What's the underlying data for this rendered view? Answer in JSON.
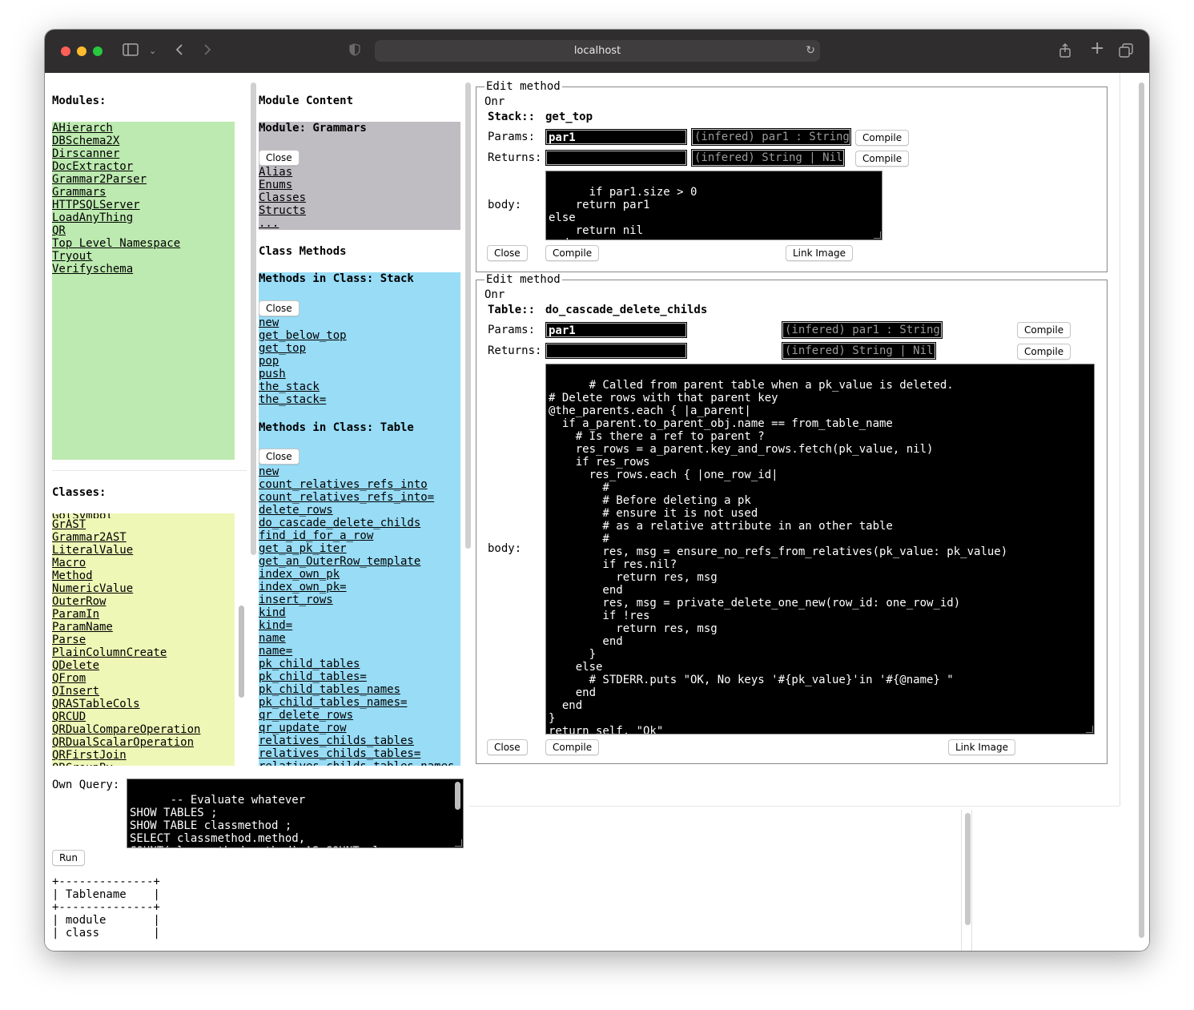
{
  "browser": {
    "url": "localhost"
  },
  "modules": {
    "title": "Modules:",
    "items": [
      "AHierarch",
      "DBSchema2X",
      "Dirscanner",
      "DocExtractor",
      "Grammar2Parser",
      "Grammars",
      "HTTPSQLServer",
      "LoadAnyThing",
      "QR",
      "Top Level Namespace",
      "Tryout",
      "Verifyschema"
    ]
  },
  "classes": {
    "title": "Classes:",
    "partial_top": "GotSymbol",
    "items": [
      "GrAST",
      "Grammar2AST",
      "LiteralValue",
      "Macro",
      "Method",
      "NumericValue",
      "OuterRow",
      "ParamIn",
      "ParamName",
      "Parse",
      "PlainColumnCreate",
      "QDelete",
      "QFrom",
      "QInsert",
      "QRASTableCols",
      "QRCUD",
      "QRDualCompareOperation",
      "QRDualScalarOperation",
      "QRFirstJoin"
    ],
    "partial_bottom": "QRGroupBy"
  },
  "module_content": {
    "title": "Module Content",
    "module_header": "Module: Grammars",
    "close_label": "Close",
    "items": [
      "Alias",
      "Enums",
      "Classes",
      "Structs",
      "..."
    ]
  },
  "class_methods": {
    "title": "Class Methods",
    "stack": {
      "header": "Methods in Class: Stack",
      "close_label": "Close",
      "items": [
        "new",
        "get_below_top",
        "get_top",
        "pop",
        "push",
        "the_stack",
        "the_stack="
      ]
    },
    "table": {
      "header": "Methods in Class: Table",
      "close_label": "Close",
      "items": [
        "new",
        "count_relatives_refs_into",
        "count_relatives_refs_into=",
        "delete_rows",
        "do_cascade_delete_childs",
        "find_id_for_a_row",
        "get_a_pk_iter",
        "get_an_OuterRow_template",
        "index_own_pk",
        "index_own_pk=",
        "insert_rows",
        "kind",
        "kind=",
        "name",
        "name=",
        "pk_child_tables",
        "pk_child_tables=",
        "pk_child_tables_names",
        "pk_child_tables_names=",
        "qr_delete_rows",
        "qr_update_row",
        "relatives_childs_tables",
        "relatives_childs_tables="
      ],
      "partial_bottom": "relatives_childs_tables_names"
    }
  },
  "edit1": {
    "legend": "Edit method",
    "owner": "Onr",
    "class_label": "Stack::",
    "method_name": "get_top",
    "params_label": "Params:",
    "params_value": "par1",
    "params_inferred": "(infered) par1 : String",
    "returns_label": "Returns:",
    "returns_value": "",
    "returns_inferred": "(infered) String | Nil",
    "compile_label": "Compile",
    "body_label": "body:",
    "body": "if par1.size > 0\n    return par1\nelse\n    return nil\nend",
    "close_label": "Close",
    "link_image_label": "Link Image"
  },
  "edit2": {
    "legend": "Edit method",
    "owner": "Onr",
    "class_label": "Table::",
    "method_name": "do_cascade_delete_childs",
    "params_label": "Params:",
    "params_value": "par1",
    "params_inferred": "(infered) par1 : String",
    "returns_label": "Returns:",
    "returns_value": "",
    "returns_inferred": "(infered) String | Nil",
    "compile_label": "Compile",
    "body_label": "body:",
    "body": "# Called from parent table when a pk_value is deleted.\n# Delete rows with that parent key\n@the_parents.each { |a_parent|\n  if a_parent.to_parent_obj.name == from_table_name\n    # Is there a ref to parent ?\n    res_rows = a_parent.key_and_rows.fetch(pk_value, nil)\n    if res_rows\n      res_rows.each { |one_row_id|\n        #\n        # Before deleting a pk\n        # ensure it is not used\n        # as a relative attribute in an other table\n        #\n        res, msg = ensure_no_refs_from_relatives(pk_value: pk_value)\n        if res.nil?\n          return res, msg\n        end\n        res, msg = private_delete_one_new(row_id: one_row_id)\n        if !res\n          return res, msg\n        end\n      }\n    else\n      # STDERR.puts \"OK, No keys '#{pk_value}'in '#{@name} \"\n    end\n  end\n}\nreturn self, \"Ok\"",
    "close_label": "Close",
    "link_image_label": "Link Image"
  },
  "query": {
    "label": "Own Query:",
    "text": "-- Evaluate whatever\nSHOW TABLES ;\nSHOW TABLE classmethod ;\nSELECT classmethod.method,\nCOUNT(classmethod.method) AS COUNT_classes",
    "run_label": "Run",
    "result": "+--------------+\n| Tablename    |\n+--------------+\n| module       |\n| class        |"
  },
  "colors": {
    "modules_bg": "#bdeab0",
    "classes_bg": "#eef7b6",
    "module_content_bg": "#bfbcc2",
    "class_methods_bg": "#98dcf6",
    "titlebar": "#2f2d2e"
  }
}
